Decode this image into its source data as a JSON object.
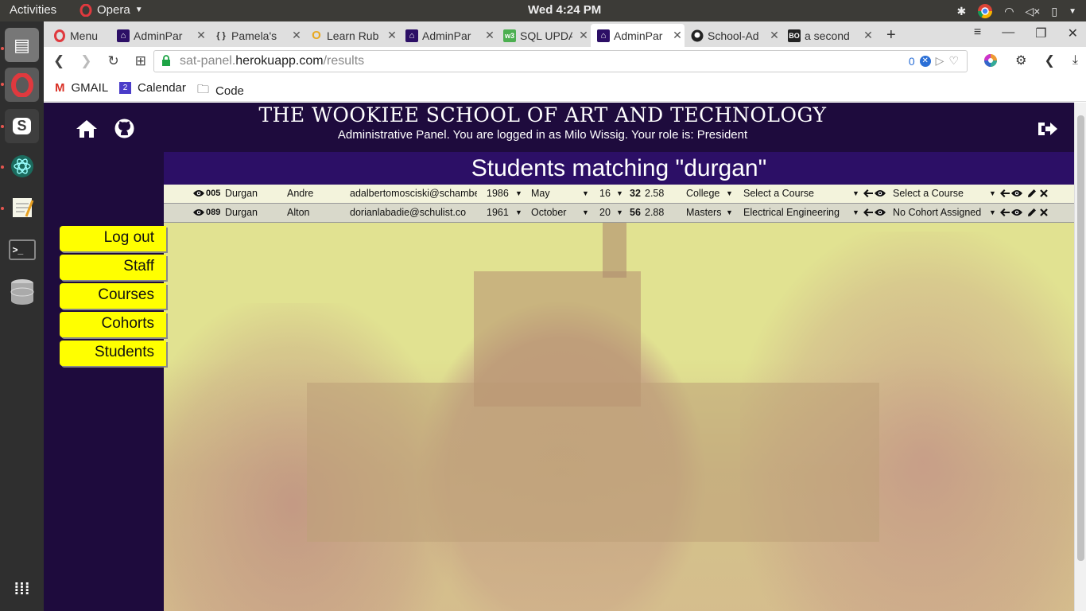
{
  "topbar": {
    "activities": "Activities",
    "app_name": "Opera",
    "clock": "Wed  4:24 PM"
  },
  "dock": {
    "items": [
      "files-icon",
      "opera-icon",
      "slack-icon",
      "atom-icon",
      "text-editor-icon",
      "terminal-icon",
      "database-icon",
      "apps-grid-icon"
    ]
  },
  "tabs": [
    {
      "title": "Menu"
    },
    {
      "title": "AdminPar"
    },
    {
      "title": "Pamela's"
    },
    {
      "title": "Learn Rub"
    },
    {
      "title": "AdminPar"
    },
    {
      "title": "SQL UPDA"
    },
    {
      "title": "AdminPar"
    },
    {
      "title": "School-Ad"
    },
    {
      "title": "a second"
    }
  ],
  "address": {
    "host_prefix": "sat-panel.",
    "host": "herokuapp.com",
    "path": "/results",
    "badge_count": "0"
  },
  "bookmarks": [
    {
      "label": "GMAIL"
    },
    {
      "label": "Calendar"
    },
    {
      "label": "Code"
    }
  ],
  "header": {
    "school_name": "THE WOOKIEE SCHOOL OF ART AND TECHNOLOGY",
    "subtitle": "Administrative Panel. You are logged in as Milo Wissig. Your role is: President"
  },
  "results": {
    "title": "Students matching \"durgan\"",
    "rows": [
      {
        "id": "005",
        "last": "Durgan",
        "first": "Andre",
        "email": "adalbertomosciski@schamberger.com",
        "year": "1986",
        "month": "May",
        "day": "16",
        "age": "32",
        "gpa": "2.58",
        "education": "College",
        "course": "Select a Course",
        "cohort": "Select a Course"
      },
      {
        "id": "089",
        "last": "Durgan",
        "first": "Alton",
        "email": "dorianlabadie@schulist.co",
        "year": "1961",
        "month": "October",
        "day": "20",
        "age": "56",
        "gpa": "2.88",
        "education": "Masters",
        "course": "Electrical Engineering",
        "cohort": "No Cohort Assigned"
      }
    ]
  },
  "sidenav": {
    "items": [
      {
        "label": "Log out"
      },
      {
        "label": "Staff"
      },
      {
        "label": "Courses"
      },
      {
        "label": "Cohorts"
      },
      {
        "label": "Students"
      }
    ]
  },
  "colors": {
    "page_bg": "#1e0b3d",
    "title_bar": "#2c0f66",
    "nav_button": "#ffff00",
    "row_light": "#f3f3dc",
    "row_dark": "#d9d9cb"
  }
}
